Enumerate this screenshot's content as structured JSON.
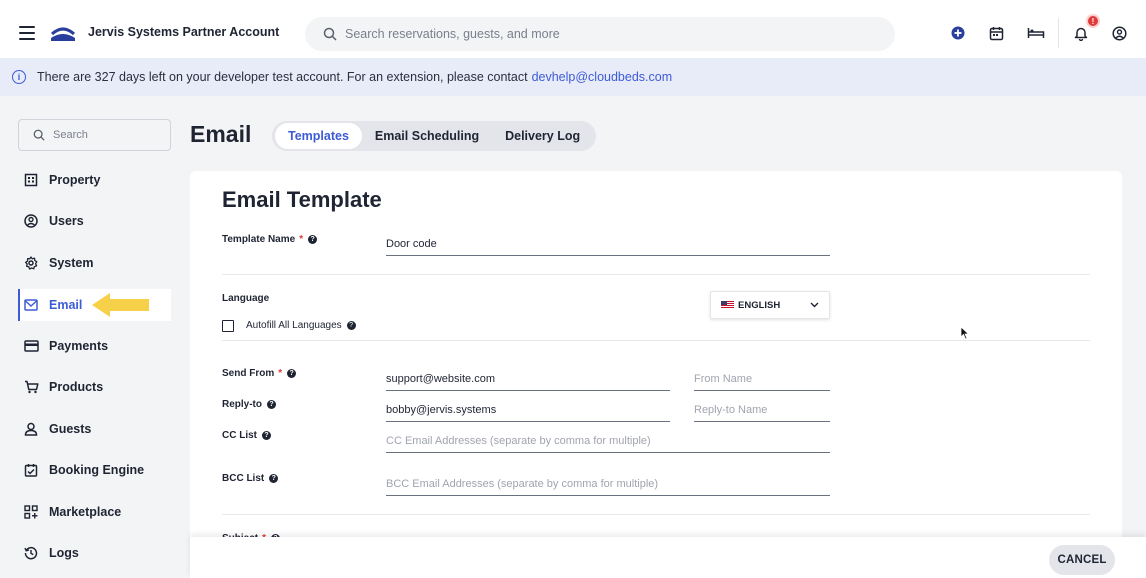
{
  "header": {
    "account_name": "Jervis Systems Partner Account",
    "search_placeholder": "Search reservations, guests, and more",
    "notification_count": "!"
  },
  "banner": {
    "message": "There are 327 days left on your developer test account. For an extension, please contact",
    "contact_email": "devhelp@cloudbeds.com"
  },
  "sidebar": {
    "search_placeholder": "Search",
    "items": [
      {
        "label": "Property",
        "icon": "building-icon"
      },
      {
        "label": "Users",
        "icon": "user-circle-icon"
      },
      {
        "label": "System",
        "icon": "gear-icon"
      },
      {
        "label": "Email",
        "icon": "mail-icon",
        "active": true
      },
      {
        "label": "Payments",
        "icon": "credit-card-icon"
      },
      {
        "label": "Products",
        "icon": "cart-icon"
      },
      {
        "label": "Guests",
        "icon": "person-icon"
      },
      {
        "label": "Booking Engine",
        "icon": "calendar-check-icon"
      },
      {
        "label": "Marketplace",
        "icon": "grid-plus-icon"
      },
      {
        "label": "Logs",
        "icon": "history-icon"
      }
    ]
  },
  "page": {
    "title": "Email",
    "tabs": [
      {
        "label": "Templates",
        "active": true
      },
      {
        "label": "Email Scheduling"
      },
      {
        "label": "Delivery Log"
      }
    ]
  },
  "form": {
    "title": "Email Template",
    "template_name_label": "Template Name",
    "template_name_value": "Door code",
    "language_label": "Language",
    "language_value": "ENGLISH",
    "autofill_label": "Autofill All Languages",
    "send_from_label": "Send From",
    "send_from_value": "support@website.com",
    "from_name_placeholder": "From Name",
    "reply_to_label": "Reply-to",
    "reply_to_value": "bobby@jervis.systems",
    "reply_to_name_placeholder": "Reply-to Name",
    "cc_label": "CC List",
    "cc_placeholder": "CC Email Addresses (separate by comma for multiple)",
    "bcc_label": "BCC List",
    "bcc_placeholder": "BCC Email Addresses (separate by comma for multiple)",
    "subject_label": "Subject"
  },
  "footer": {
    "cancel_label": "CANCEL"
  },
  "colors": {
    "accent": "#3e5bd6",
    "highlight_arrow": "#f7d04a",
    "required": "#e03a3a"
  }
}
